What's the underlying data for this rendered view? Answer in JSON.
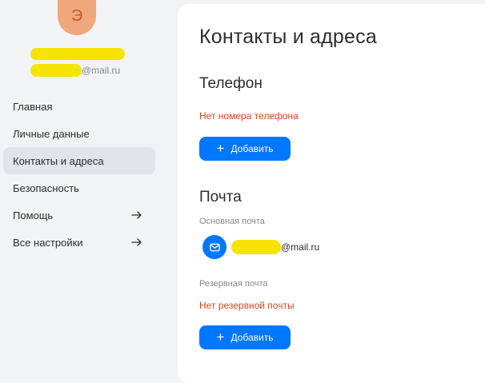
{
  "profile": {
    "avatar_letter": "Э",
    "email_suffix": "@mail.ru"
  },
  "sidebar": {
    "items": [
      {
        "label": "Главная",
        "active": false,
        "arrow": false
      },
      {
        "label": "Личные данные",
        "active": false,
        "arrow": false
      },
      {
        "label": "Контакты и адреса",
        "active": true,
        "arrow": false
      },
      {
        "label": "Безопасность",
        "active": false,
        "arrow": false
      },
      {
        "label": "Помощь",
        "active": false,
        "arrow": true
      },
      {
        "label": "Все настройки",
        "active": false,
        "arrow": true
      }
    ]
  },
  "main": {
    "title": "Контакты и адреса",
    "phone": {
      "heading": "Телефон",
      "empty_text": "Нет номера телефона",
      "add_label": "Добавить"
    },
    "mail": {
      "heading": "Почта",
      "primary_label": "Основная почта",
      "primary_suffix": "@mail.ru",
      "backup_label": "Резервная почта",
      "backup_empty_text": "Нет резервной почты",
      "add_label": "Добавить"
    }
  },
  "colors": {
    "accent": "#0077ff",
    "error": "#d3461e",
    "avatar_bg": "#f0a77b",
    "redaction": "#f7e301"
  },
  "icons": {
    "nav_arrow": "arrow-right-icon",
    "add": "plus-icon",
    "mail": "envelope-icon"
  }
}
